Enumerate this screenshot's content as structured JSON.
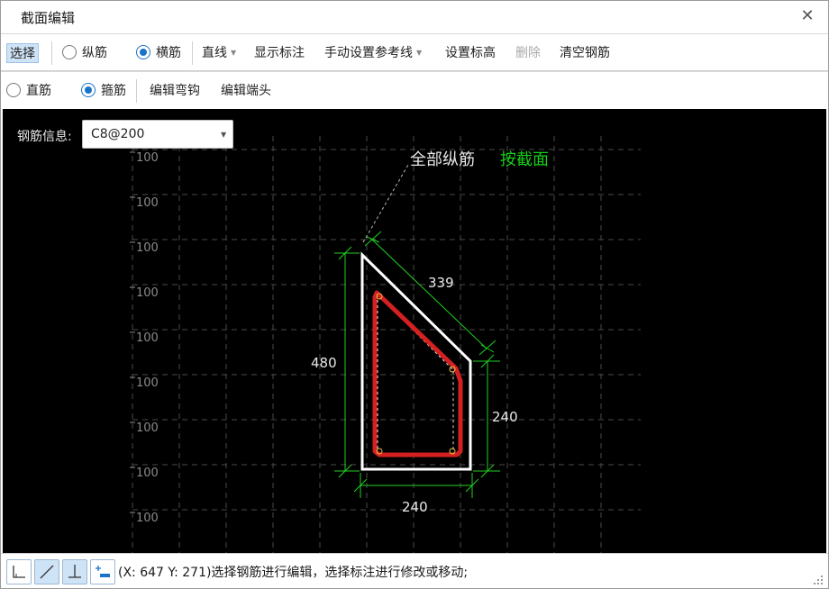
{
  "window": {
    "title": "截面编辑",
    "close_icon": "close-icon"
  },
  "toolbar1": {
    "select": "选择",
    "longitudinal": "纵筋",
    "stirrup_horizontal": "横筋",
    "line": "直线",
    "show_annotation": "显示标注",
    "manual_reference": "手动设置参考线",
    "set_elevation": "设置标高",
    "delete": "删除",
    "clear_rebar": "清空钢筋",
    "selected_radio": "横筋"
  },
  "toolbar2": {
    "straight_bar": "直筋",
    "stirrup": "箍筋",
    "edit_hook": "编辑弯钩",
    "edit_end": "编辑端头",
    "selected_radio": "箍筋"
  },
  "canvas": {
    "info_label": "钢筋信息:",
    "info_value": "C8@200",
    "grid_label": "100",
    "grid_label_count": 9,
    "all_longitudinal": "全部纵筋",
    "by_section": "按截面",
    "dim_top": "339",
    "dim_left": "480",
    "dim_right": "240",
    "dim_bottom": "240",
    "colors": {
      "background": "#000000",
      "section_outline": "#ffffff",
      "stirrup": "#d42020",
      "dimension": "#1fd21f",
      "grid": "#4a4a4a",
      "accent_label": "#16d016"
    }
  },
  "statusbar": {
    "text": "(X: 647 Y: 271)选择钢筋进行编辑，选择标注进行修改或移动;",
    "buttons": [
      "orthogonal-icon",
      "line-icon",
      "perpendicular-icon",
      "offset-icon"
    ]
  }
}
